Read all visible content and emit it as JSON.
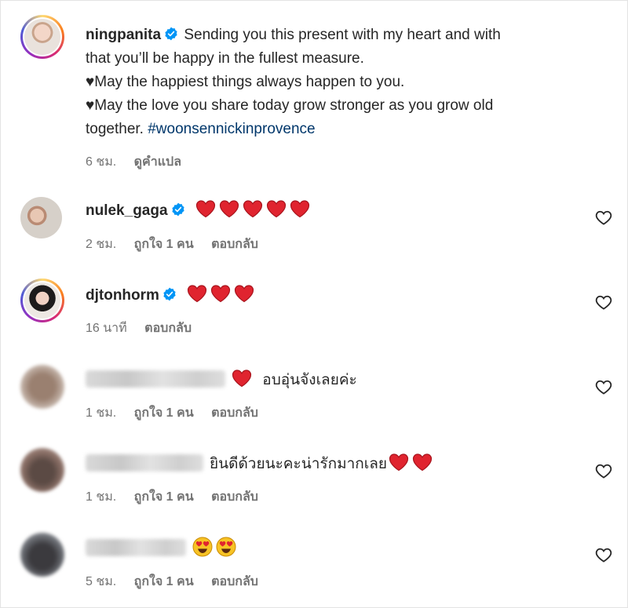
{
  "comments": [
    {
      "username": "ningpanita",
      "verified": true,
      "text_lines": [
        "Sending you this present with my heart and with",
        "that you’ll be happy in the fullest measure.",
        "♥May the happiest things always happen to you.",
        "♥May the love you share today grow stronger as you grow old",
        "together."
      ],
      "hashtag": "#woonsennickinprovence",
      "time": "6 ชม.",
      "translate_label": "ดูคำแปล"
    },
    {
      "username": "nulek_gaga",
      "verified": true,
      "hearts": 5,
      "time": "2 ชม.",
      "likes": "ถูกใจ 1 คน",
      "reply_label": "ตอบกลับ"
    },
    {
      "username": "djtonhorm",
      "verified": true,
      "hearts": 3,
      "time": "16 นาที",
      "reply_label": "ตอบกลับ"
    },
    {
      "username_blurred": true,
      "text": "อบอุ่นจังเลยค่ะ",
      "time": "1 ชม.",
      "likes": "ถูกใจ 1 คน",
      "reply_label": "ตอบกลับ"
    },
    {
      "username_blurred": true,
      "text": "ยินดีด้วยนะคะน่ารักมากเลย",
      "time": "1 ชม.",
      "likes": "ถูกใจ 1 คน",
      "reply_label": "ตอบกลับ"
    },
    {
      "username_blurred": true,
      "emoji": "heart-eyes",
      "time": "5 ชม.",
      "likes": "ถูกใจ 1 คน",
      "reply_label": "ตอบกลับ"
    }
  ],
  "colors": {
    "text": "#262626",
    "meta": "#737373",
    "hashtag": "#00376b",
    "verified": "#0095f6",
    "heart_red": "#e0242f"
  },
  "icons": {
    "verified": "verified-badge-icon",
    "like": "heart-outline-icon",
    "reaction": "red-heart-emoji"
  }
}
